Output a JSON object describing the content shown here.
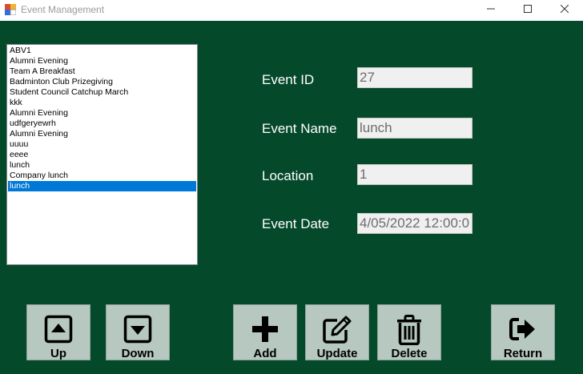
{
  "window": {
    "title": "Event Management",
    "controls": [
      "minimize",
      "maximize",
      "close"
    ],
    "background_color": "#05492b"
  },
  "event_list": {
    "items": [
      "ABV1",
      "Alumni Evening",
      "Team A Breakfast",
      "Badminton Club Prizegiving",
      "Student Council Catchup March",
      "kkk",
      "Alumni Evening",
      "udfgeryewrh",
      "Alumni Evening",
      "uuuu",
      "eeee",
      "lunch",
      "Company lunch",
      "lunch"
    ],
    "selected_index": 13,
    "selection_color": "#0078d7"
  },
  "form": {
    "event_id": {
      "label": "Event ID",
      "value": "27"
    },
    "event_name": {
      "label": "Event Name",
      "value": "lunch"
    },
    "location": {
      "label": "Location",
      "value": "1"
    },
    "event_date": {
      "label": "Event Date",
      "value": "4/05/2022 12:00:0"
    }
  },
  "buttons": {
    "up": {
      "label": "Up",
      "icon": "caret-up-square-icon"
    },
    "down": {
      "label": "Down",
      "icon": "caret-down-square-icon"
    },
    "add": {
      "label": "Add",
      "icon": "plus-icon"
    },
    "update": {
      "label": "Update",
      "icon": "edit-icon"
    },
    "delete": {
      "label": "Delete",
      "icon": "trash-icon"
    },
    "return": {
      "label": "Return",
      "icon": "sign-out-icon"
    }
  }
}
